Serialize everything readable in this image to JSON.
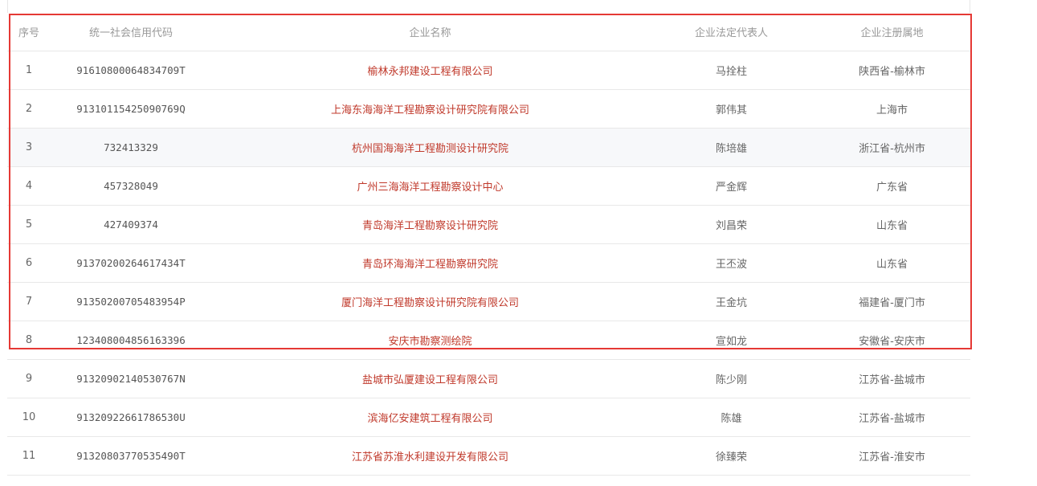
{
  "table": {
    "headers": {
      "index": "序号",
      "credit_code": "统一社会信用代码",
      "company_name": "企业名称",
      "legal_rep": "企业法定代表人",
      "location": "企业注册属地"
    },
    "rows": [
      {
        "index": "1",
        "credit_code": "91610800064834709T",
        "company_name": "榆林永邦建设工程有限公司",
        "legal_rep": "马拴柱",
        "location": "陕西省-榆林市"
      },
      {
        "index": "2",
        "credit_code": "91310115425090769Q",
        "company_name": "上海东海海洋工程勘察设计研究院有限公司",
        "legal_rep": "郭伟其",
        "location": "上海市"
      },
      {
        "index": "3",
        "credit_code": "732413329",
        "company_name": "杭州国海海洋工程勘测设计研究院",
        "legal_rep": "陈培雄",
        "location": "浙江省-杭州市"
      },
      {
        "index": "4",
        "credit_code": "457328049",
        "company_name": "广州三海海洋工程勘察设计中心",
        "legal_rep": "严金辉",
        "location": "广东省"
      },
      {
        "index": "5",
        "credit_code": "427409374",
        "company_name": "青岛海洋工程勘察设计研究院",
        "legal_rep": "刘昌荣",
        "location": "山东省"
      },
      {
        "index": "6",
        "credit_code": "91370200264617434T",
        "company_name": "青岛环海海洋工程勘察研究院",
        "legal_rep": "王丕波",
        "location": "山东省"
      },
      {
        "index": "7",
        "credit_code": "91350200705483954P",
        "company_name": "厦门海洋工程勘察设计研究院有限公司",
        "legal_rep": "王金坑",
        "location": "福建省-厦门市"
      },
      {
        "index": "8",
        "credit_code": "123408004856163396",
        "company_name": "安庆市勘察测绘院",
        "legal_rep": "宣如龙",
        "location": "安徽省-安庆市"
      },
      {
        "index": "9",
        "credit_code": "91320902140530767N",
        "company_name": "盐城市弘厦建设工程有限公司",
        "legal_rep": "陈少刚",
        "location": "江苏省-盐城市"
      },
      {
        "index": "10",
        "credit_code": "91320922661786530U",
        "company_name": "滨海亿安建筑工程有限公司",
        "legal_rep": "陈雄",
        "location": "江苏省-盐城市"
      },
      {
        "index": "11",
        "credit_code": "91320803770535490T",
        "company_name": "江苏省苏淮水利建设开发有限公司",
        "legal_rep": "徐臻荣",
        "location": "江苏省-淮安市"
      }
    ]
  },
  "colors": {
    "link": "#c0392b",
    "highlight_border": "#e53935",
    "header_text": "#999999"
  }
}
